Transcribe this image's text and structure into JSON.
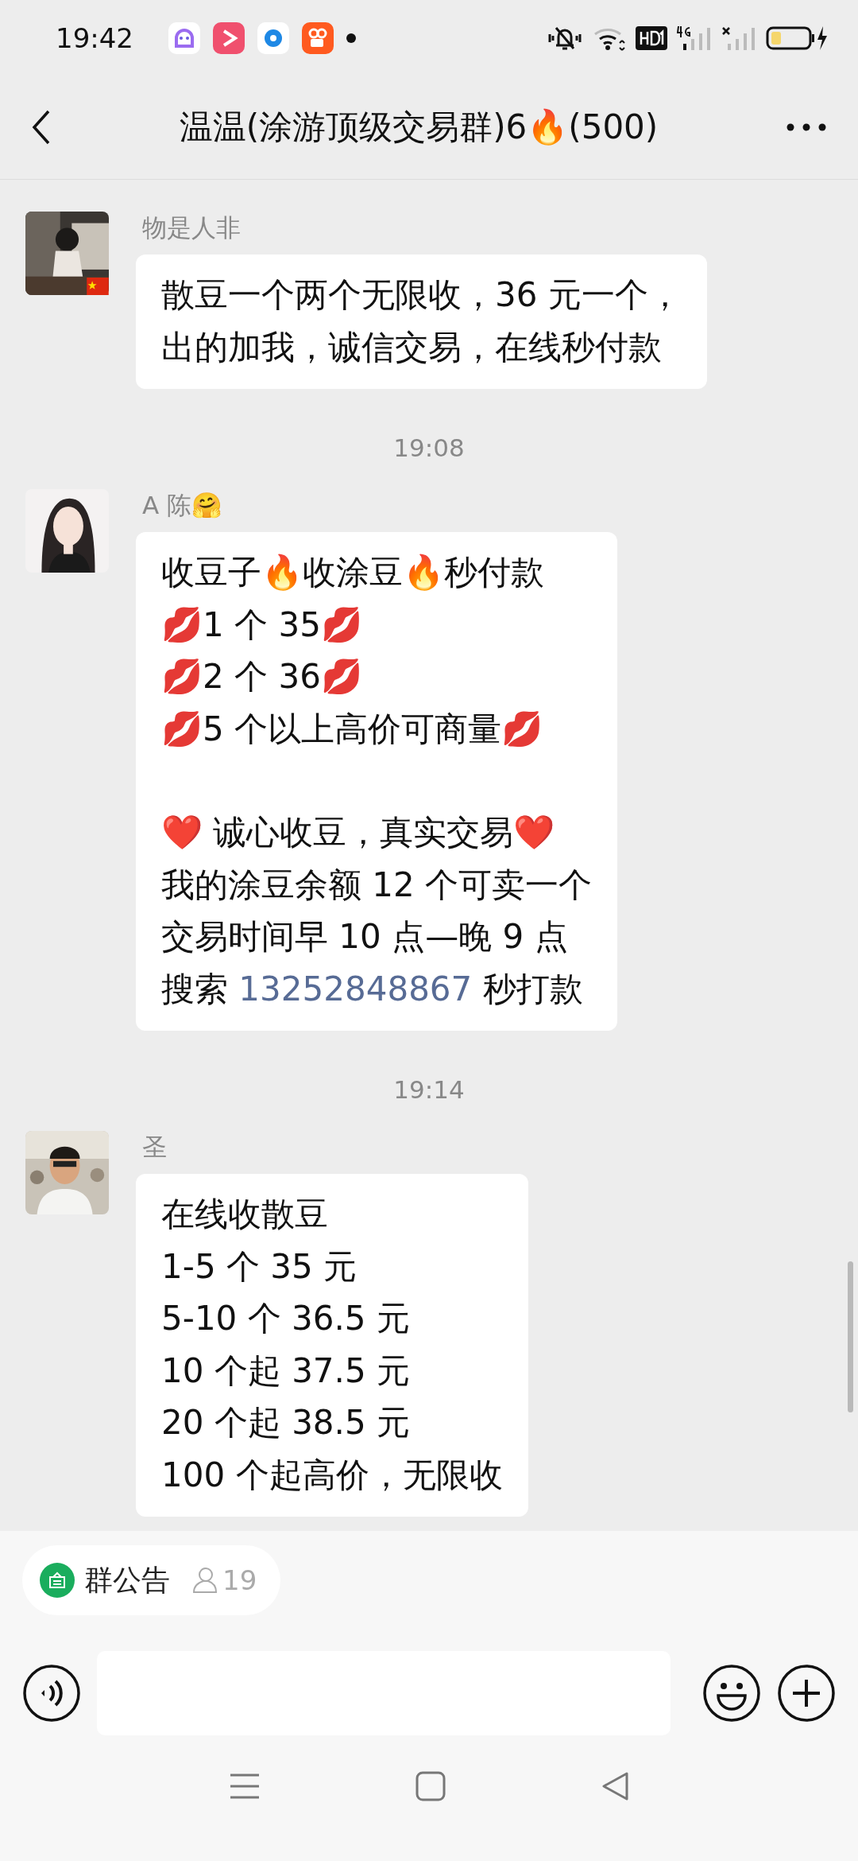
{
  "status_bar": {
    "time": "19:42"
  },
  "header": {
    "title": "温温(涂游顶级交易群)6🔥(500)"
  },
  "chat": [
    {
      "kind": "message",
      "sender": "物是人非",
      "flag": true,
      "lines": [
        {
          "kind": "text",
          "text": "散豆一个两个无限收，36 元一个，"
        },
        {
          "kind": "text",
          "text": "出的加我，诚信交易，在线秒付款"
        }
      ]
    },
    {
      "kind": "time",
      "text": "19:08"
    },
    {
      "kind": "message",
      "sender": "A 陈🤗",
      "flag": false,
      "lines": [
        {
          "kind": "text",
          "text": "收豆子🔥收涂豆🔥秒付款"
        },
        {
          "kind": "text",
          "text": "💋1 个 35💋"
        },
        {
          "kind": "text",
          "text": "💋2 个 36💋"
        },
        {
          "kind": "text",
          "text": "💋5 个以上高价可商量💋"
        },
        {
          "kind": "gap"
        },
        {
          "kind": "text",
          "text": "❤️ 诚心收豆，真实交易❤️"
        },
        {
          "kind": "text",
          "text": "我的涂豆余额 12 个可卖一个"
        },
        {
          "kind": "text",
          "text": "交易时间早 10 点—晚 9 点"
        },
        {
          "kind": "link",
          "before": "搜索 ",
          "link": "13252848867",
          "after": " 秒打款"
        }
      ]
    },
    {
      "kind": "time",
      "text": "19:14"
    },
    {
      "kind": "message",
      "sender": "圣",
      "flag": false,
      "lines": [
        {
          "kind": "text",
          "text": "在线收散豆"
        },
        {
          "kind": "text",
          "text": "1-5 个 35 元"
        },
        {
          "kind": "text",
          "text": "5-10 个 36.5 元"
        },
        {
          "kind": "text",
          "text": "10 个起 37.5 元"
        },
        {
          "kind": "text",
          "text": "20 个起 38.5 元"
        },
        {
          "kind": "text",
          "text": "100 个起高价，无限收"
        }
      ]
    }
  ],
  "notice": {
    "label": "群公告",
    "count": "19"
  }
}
